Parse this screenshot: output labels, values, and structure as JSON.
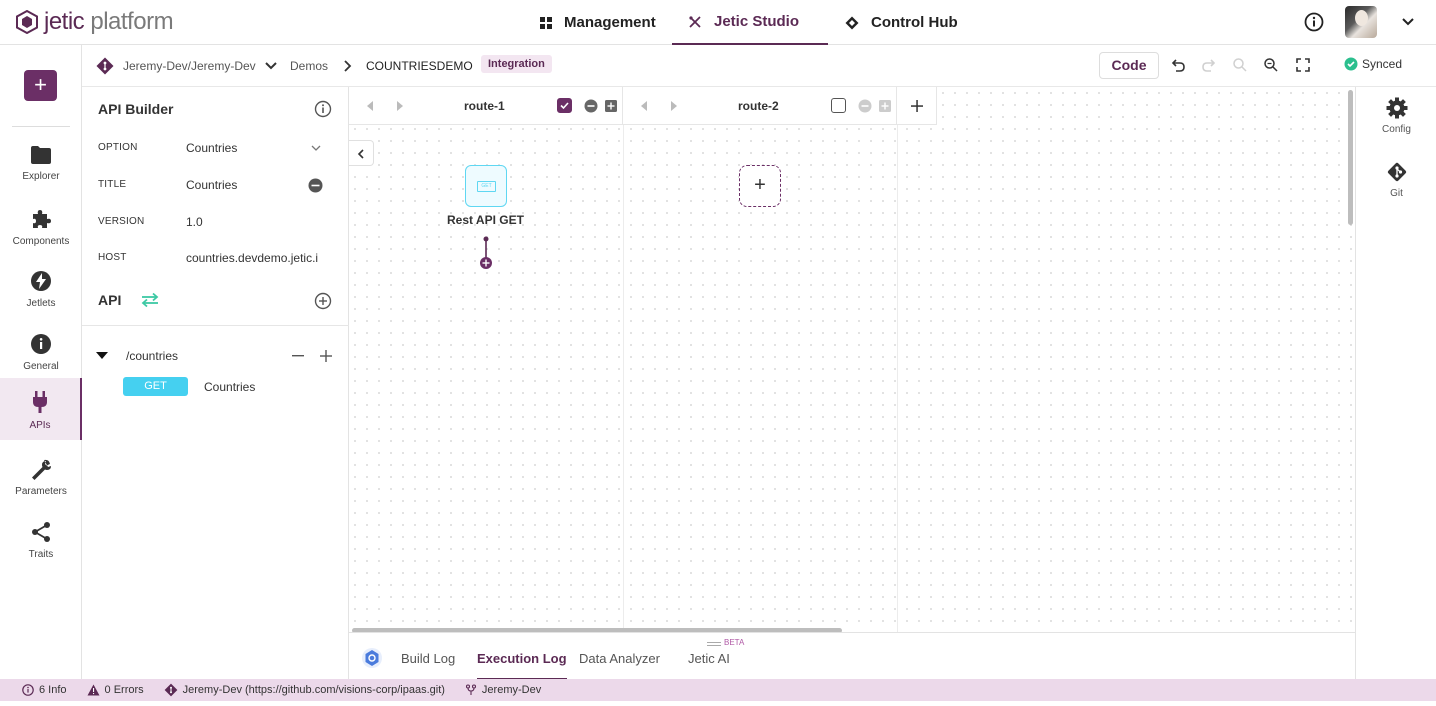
{
  "app": {
    "logo_main": "jetic",
    "logo_sub": "platform"
  },
  "topnav": [
    {
      "label": "Management",
      "icon": "grid-icon"
    },
    {
      "label": "Jetic Studio",
      "icon": "tools-icon"
    },
    {
      "label": "Control Hub",
      "icon": "hub-icon"
    }
  ],
  "rail": [
    {
      "label": "Explorer",
      "icon": "folder-icon"
    },
    {
      "label": "Components",
      "icon": "puzzle-icon"
    },
    {
      "label": "Jetlets",
      "icon": "bolt-icon"
    },
    {
      "label": "General",
      "icon": "info-icon"
    },
    {
      "label": "APIs",
      "icon": "plug-icon"
    },
    {
      "label": "Parameters",
      "icon": "wrench-icon"
    },
    {
      "label": "Traits",
      "icon": "share-icon"
    }
  ],
  "rail_add": "+",
  "breadcrumb": {
    "repo": "Jeremy-Dev/Jeremy-Dev",
    "folder": "Demos",
    "project": "COUNTRIESDEMO",
    "tag": "Integration"
  },
  "toolbar": {
    "code_label": "Code",
    "synced_label": "Synced"
  },
  "panel": {
    "title": "API Builder",
    "fields": [
      {
        "label": "OPTION",
        "value": "Countries"
      },
      {
        "label": "TITLE",
        "value": "Countries"
      },
      {
        "label": "VERSION",
        "value": "1.0"
      },
      {
        "label": "HOST",
        "value": "countries.devdemo.jetic.i"
      }
    ],
    "api_title": "API",
    "path": "/countries",
    "method": "GET",
    "method_desc": "Countries"
  },
  "routes": [
    {
      "name": "route-1",
      "checked": true
    },
    {
      "name": "route-2",
      "checked": false
    }
  ],
  "canvas": {
    "node_label": "Rest API GET",
    "node_icon_text": "GET",
    "add_node": "+"
  },
  "right_rail": [
    {
      "label": "Config",
      "icon": "gear-icon"
    },
    {
      "label": "Git",
      "icon": "git-icon"
    }
  ],
  "bottom_tabs": [
    {
      "label": "Build Log",
      "active": false
    },
    {
      "label": "Execution Log",
      "active": true
    },
    {
      "label": "Data Analyzer",
      "active": false
    },
    {
      "label": "Jetic AI",
      "active": false
    }
  ],
  "beta_label": "BETA",
  "status": {
    "info": "6 Info",
    "errors": "0 Errors",
    "repo": "Jeremy-Dev (https://github.com/visions-corp/ipaas.git)",
    "branch": "Jeremy-Dev"
  },
  "colors": {
    "brand": "#6b2f66",
    "accent_cyan": "#45d0f0",
    "status_bg": "#ecd9ea",
    "synced_green": "#2bbf8e"
  }
}
